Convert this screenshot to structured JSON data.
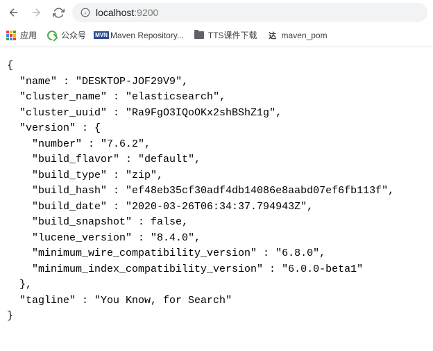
{
  "address": {
    "host": "localhost",
    "port": ":9200"
  },
  "bookmarks": {
    "apps": "应用",
    "gzh": "公众号",
    "maven_repo": "Maven Repository...",
    "tts": "TTS课件下载",
    "maven_pom": "maven_pom",
    "da": "达"
  },
  "response": {
    "name": "DESKTOP-JOF29V9",
    "cluster_name": "elasticsearch",
    "cluster_uuid": "Ra9FgO3IQoOKx2shBShZ1g",
    "version": {
      "number": "7.6.2",
      "build_flavor": "default",
      "build_type": "zip",
      "build_hash": "ef48eb35cf30adf4db14086e8aabd07ef6fb113f",
      "build_date": "2020-03-26T06:34:37.794943Z",
      "build_snapshot": "false",
      "lucene_version": "8.4.0",
      "minimum_wire_compatibility_version": "6.8.0",
      "minimum_index_compatibility_version": "6.0.0-beta1"
    },
    "tagline": "You Know, for Search"
  }
}
